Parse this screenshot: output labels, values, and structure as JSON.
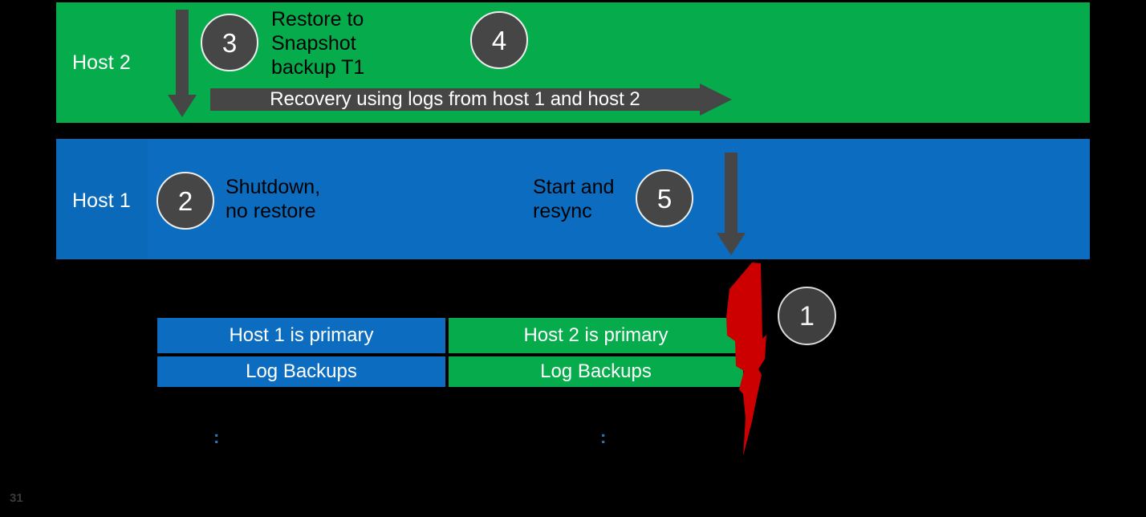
{
  "slide": {
    "page_number": "31",
    "background_color": "#000000"
  },
  "colors": {
    "green": "#06AC4B",
    "blue": "#0C6DC0",
    "blue_label_cell": "#0A6AB9",
    "gray_accent": "#464646",
    "red_bolt": "#CC0000",
    "circle_ring": "#EDEDED",
    "colon_blue": "#2E75B6",
    "page_number": "#3B3B38"
  },
  "bands": {
    "host2": {
      "label": "Host 2",
      "color": "#06AC4B"
    },
    "host1": {
      "label": "Host 1",
      "color": "#0C6DC0"
    }
  },
  "steps": [
    {
      "number": "1",
      "context": "failure-event"
    },
    {
      "number": "2",
      "context": "host1-shutdown"
    },
    {
      "number": "3",
      "context": "host2-restore"
    },
    {
      "number": "4",
      "context": "host2-recovery"
    },
    {
      "number": "5",
      "context": "host1-start-resync"
    }
  ],
  "annotations": {
    "restore": "Restore to\nSnapshot\nbackup T1",
    "shutdown": "Shutdown,\nno restore",
    "start_resync": "Start and\nresync"
  },
  "recovery_arrow": {
    "label": "Recovery using logs from host 1 and host 2",
    "color": "#464646"
  },
  "arrows": {
    "host2_down": "down-arrow",
    "host1_down": "down-arrow"
  },
  "timeline": {
    "rows": [
      {
        "left": {
          "label": "Host 1 is primary",
          "color": "#0C6DC0"
        },
        "right": {
          "label": "Host 2 is primary",
          "color": "#06AC4B"
        }
      },
      {
        "left": {
          "label": "Log Backups",
          "color": "#0C6DC0"
        },
        "right": {
          "label": "Log Backups",
          "color": "#06AC4B"
        }
      }
    ]
  },
  "markers": {
    "colon_left": ":",
    "colon_right": ":"
  },
  "icons": {
    "lightning_bolt": "lightning-bolt-icon"
  }
}
